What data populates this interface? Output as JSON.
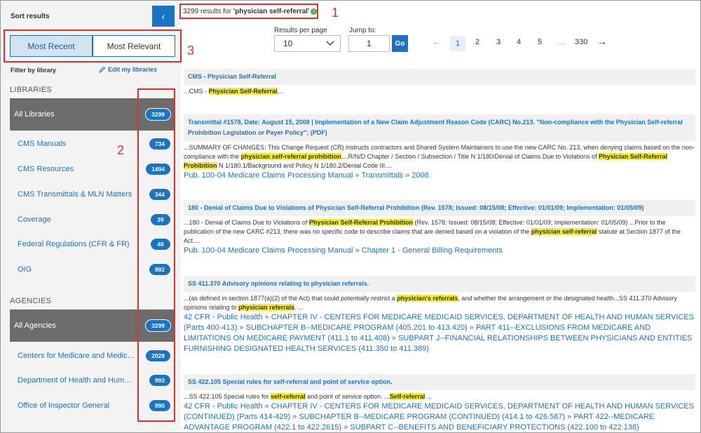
{
  "sidebar": {
    "sort_title": "Sort results",
    "collapse_icon": "‹",
    "sort_recent": "Most Recent",
    "sort_relevant": "Most Relevant",
    "filter_label": "Filter by library",
    "edit_libraries": "Edit my libraries",
    "libraries_heading": "LIBRARIES",
    "libraries": [
      {
        "label": "All Libraries",
        "count": "3299"
      },
      {
        "label": "CMS Manuals",
        "count": "734"
      },
      {
        "label": "CMS Resources",
        "count": "1494"
      },
      {
        "label": "CMS Transmittals & MLN Matters",
        "count": "344"
      },
      {
        "label": "Coverage",
        "count": "39"
      },
      {
        "label": "Federal Regulations (CFR & FR)",
        "count": "40"
      },
      {
        "label": "OIG",
        "count": "992"
      }
    ],
    "agencies_heading": "AGENCIES",
    "agencies": [
      {
        "label": "All Agencies",
        "count": "3299"
      },
      {
        "label": "Centers for Medicare and Medic…",
        "count": "2028"
      },
      {
        "label": "Department of Health and Human…",
        "count": "993"
      },
      {
        "label": "Office of Inspector General",
        "count": "990"
      }
    ]
  },
  "annotations": {
    "one": "1",
    "two": "2",
    "three": "3"
  },
  "header": {
    "results_prefix": "3299 results for ",
    "query": "'physician self-referral'",
    "per_page_label": "Results per page",
    "per_page_value": "10",
    "jump_label": "Jump to:",
    "jump_value": "1",
    "go_label": "Go",
    "pages": [
      "1",
      "2",
      "3",
      "4",
      "5",
      "...",
      "330"
    ],
    "prev_icon": "←",
    "next_icon": "→"
  },
  "results": [
    {
      "title": "CMS - Physician Self-Referral",
      "snippet": [
        {
          "t": "...CMS - "
        },
        {
          "h": "Physician Self-Referral"
        },
        {
          "t": "..."
        }
      ],
      "breadcrumb": []
    },
    {
      "title": "Transmittal #1578, Date: August 15, 2008 | Implementation of a New Claim Adjustment Reason Code (CARC) No.213. \"Non-compliance with the Physician Self-referral Prohibition Legislation or Payer Policy\"; (PDF)",
      "snippet": [
        {
          "t": "...SUMMARY OF CHANGES: This Change Request (CR) instructs contractors and Shared System Maintainers to use the new CARC No. 213, when denying claims based on the non-compliance with the "
        },
        {
          "h": "physician self-referral prohibition"
        },
        {
          "t": "....R/N/D Chapter / Section / Subsection / Title N 1/180/Denial of Claims Due to Violations of "
        },
        {
          "h": "Physician Self-Referral Prohibition"
        },
        {
          "t": " N 1/180.1/Background and Policy N 1/180.2/Denial Code III...."
        }
      ],
      "breadcrumb": [
        "Pub. 100-04 Medicare Claims Processing Manual",
        "Transmittals",
        "2008"
      ]
    },
    {
      "title": "180 - Denial of Claims Due to Violations of Physician Self-Referral Prohibition (Rev. 1578; Issued: 08/15/08; Effective: 01/01/09; Implementation: 01/05/09)",
      "snippet": [
        {
          "t": "...180 - Denial of Claims Due to Violations of "
        },
        {
          "h": "Physician Self-Referral Prohibition"
        },
        {
          "t": " (Rev. 1578; Issued: 08/15/08; Effective: 01/01/09; Implementation: 01/05/09) ...Prior to the publication of the new CARC #213, there was no specific code to describe claims that are denied based on a violation of the "
        },
        {
          "h": "physician self-referral"
        },
        {
          "t": " statute at Section 1877 of the Act...."
        }
      ],
      "breadcrumb": [
        "Pub. 100-04 Medicare Claims Processing Manual",
        "Chapter 1 - General Billing Requirements"
      ]
    },
    {
      "title": "SS 411.370 Advisory opinions relating to physician referrals.",
      "snippet": [
        {
          "t": "...(as defined in section 1877(a)(2) of the Act) that could potentially restrict a "
        },
        {
          "h": "physician's referrals"
        },
        {
          "t": ", and whether the arrangement or the designated health...SS 411.370 Advisory opinions relating to "
        },
        {
          "h": "physician referrals"
        },
        {
          "t": ". ..."
        }
      ],
      "breadcrumb": [
        "42 CFR - Public Health",
        "CHAPTER IV - CENTERS FOR MEDICARE MEDICAID SERVICES, DEPARTMENT OF HEALTH AND HUMAN SERVICES (Parts 400-413)",
        "SUBCHAPTER B--MEDICARE PROGRAM (405.201 to 413.420)",
        "PART 411--EXCLUSIONS FROM MEDICARE AND LIMITATIONS ON MEDICARE PAYMENT (411.1 to 411.408)",
        "SUBPART J--FINANCIAL RELATIONSHIPS BETWEEN PHYSICIANS AND ENTITIES FURNISHING DESIGNATED HEALTH SERVICES (411.350 to 411.389)"
      ]
    },
    {
      "title": "SS 422.105 Special rules for self-referral and point of service option.",
      "snippet": [
        {
          "t": "...SS 422.105 Special rules for "
        },
        {
          "h": "self-referral"
        },
        {
          "t": " and point of service option. ..."
        },
        {
          "h": "Self-referral"
        },
        {
          "t": " ..."
        }
      ],
      "breadcrumb": [
        "42 CFR - Public Health",
        "CHAPTER IV - CENTERS FOR MEDICARE MEDICAID SERVICES, DEPARTMENT OF HEALTH AND HUMAN SERVICES (CONTINUED) (Parts 414-429)",
        "SUBCHAPTER B--MEDICARE PROGRAM (CONTINUED) (414.1 to 426.587)",
        "PART 422--MEDICARE ADVANTAGE PROGRAM (422.1 to 422.2615)",
        "SUBPART C--BENEFITS AND BENEFICIARY PROTECTIONS (422.100 to 422.138)"
      ]
    }
  ],
  "colors": {
    "accent": "#1a73c4",
    "highlight": "#f5ec2c",
    "annotation": "#e0302b",
    "selected_bg": "#6c6c6c"
  }
}
